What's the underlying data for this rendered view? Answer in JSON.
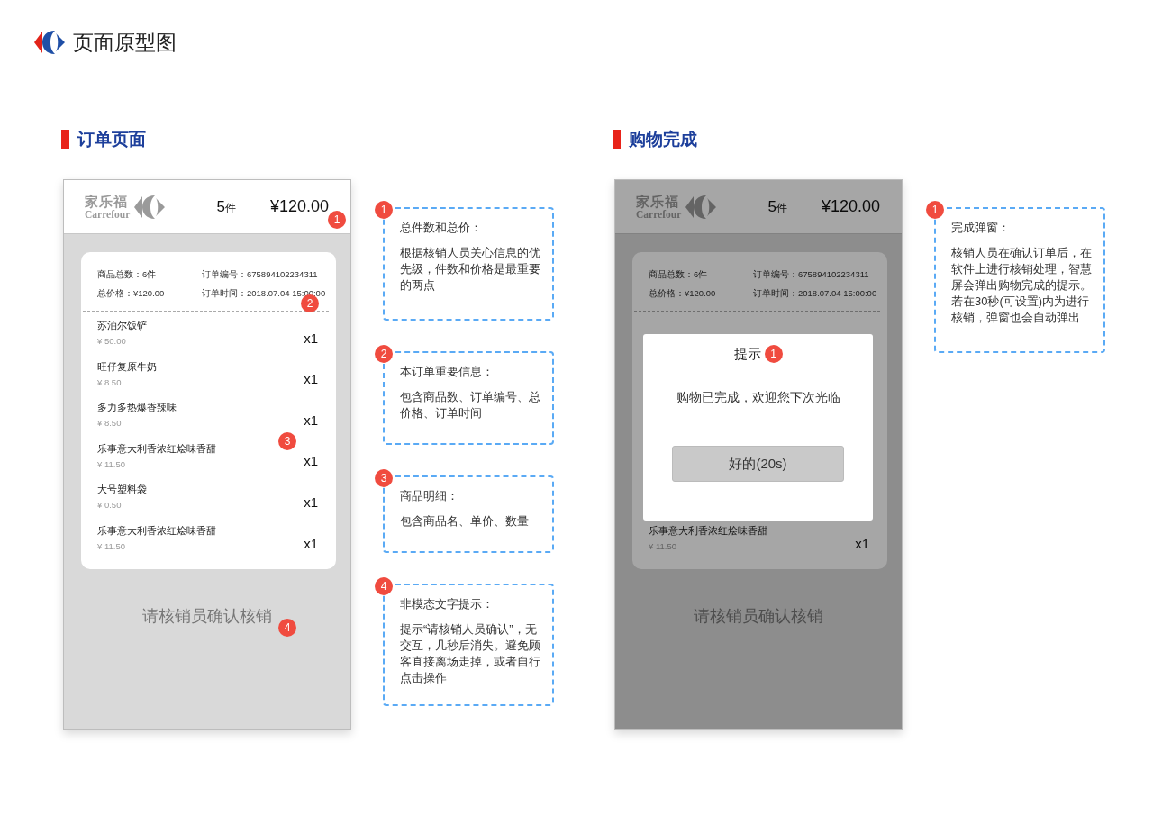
{
  "header": {
    "title": "页面原型图"
  },
  "sections": [
    {
      "title": "订单页面",
      "phone": {
        "brand": "家乐福",
        "brand_en": "Carrefour",
        "count": "5",
        "count_unit": "件",
        "total": "¥120.00",
        "dimmed": false,
        "summary": [
          "商品总数：6件",
          "订单编号：675894102234311",
          "总价格：¥120.00",
          "订单时间：2018.07.04 15:00:00"
        ],
        "items": [
          {
            "name": "苏泊尔饭铲",
            "price": "¥ 50.00",
            "qty": "x1"
          },
          {
            "name": "旺仔复原牛奶",
            "price": "¥ 8.50",
            "qty": "x1"
          },
          {
            "name": "多力多热爆香辣味",
            "price": "¥ 8.50",
            "qty": "x1"
          },
          {
            "name": "乐事意大利香浓红烩味香甜",
            "price": "¥ 11.50",
            "qty": "x1"
          },
          {
            "name": "大号塑料袋",
            "price": "¥ 0.50",
            "qty": "x1"
          },
          {
            "name": "乐事意大利香浓红烩味香甜",
            "price": "¥ 11.50",
            "qty": "x1"
          }
        ],
        "prompt": "请核销员确认核销",
        "badges": [
          "1",
          "2",
          "3",
          "4"
        ]
      },
      "notes": [
        {
          "number": "1",
          "title": "总件数和总价：",
          "body": "根据核销人员关心信息的优先级，件数和价格是最重要的两点"
        },
        {
          "number": "2",
          "title": "本订单重要信息：",
          "body": "包含商品数、订单编号、总价格、订单时间"
        },
        {
          "number": "3",
          "title": "商品明细：",
          "body": "包含商品名、单价、数量"
        },
        {
          "number": "4",
          "title": "非模态文字提示：",
          "body": "提示“请核销人员确认”，无交互，几秒后消失。避免顾客直接离场走掉，或者自行点击操作"
        }
      ]
    },
    {
      "title": "购物完成",
      "phone": {
        "brand": "家乐福",
        "brand_en": "Carrefour",
        "count": "5",
        "count_unit": "件",
        "total": "¥120.00",
        "dimmed": true,
        "summary": [
          "商品总数：6件",
          "订单编号：675894102234311",
          "总价格：¥120.00",
          "订单时间：2018.07.04 15:00:00"
        ],
        "items": [
          {
            "name": "乐事意大利香浓红烩味香甜",
            "price": "¥ 11.50",
            "qty": "x1"
          }
        ],
        "prompt": "请核销员确认核销",
        "modal": {
          "title": "提示",
          "badge": "1",
          "message": "购物已完成，欢迎您下次光临",
          "button": "好的(20s)"
        }
      },
      "notes": [
        {
          "number": "1",
          "title": "完成弹窗：",
          "body": "核销人员在确认订单后，在软件上进行核销处理，智慧屏会弹出购物完成的提示。若在30秒(可设置)内为进行核销，弹窗也会自动弹出"
        }
      ]
    }
  ]
}
